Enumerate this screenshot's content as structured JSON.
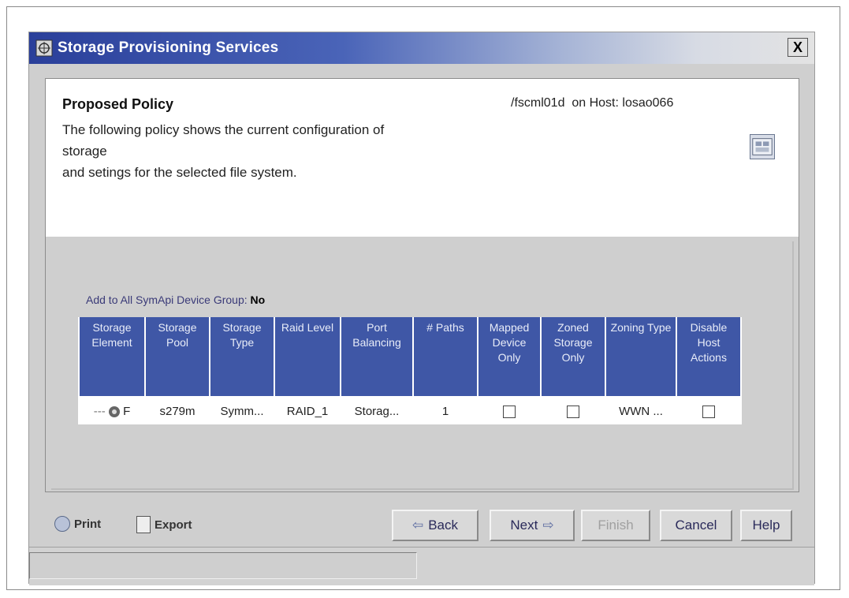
{
  "window": {
    "title": "Storage Provisioning Services",
    "close_label": "X"
  },
  "header": {
    "title": "Proposed Policy",
    "description_lines": [
      "The following policy shows the current configuration of",
      "storage",
      "and setings for the selected file system."
    ],
    "filesystem": "/fscml01d",
    "on_host_label": "on Host:",
    "host": "losao066"
  },
  "device_group": {
    "label": "Add to All SymApi Device Group:",
    "value": "No"
  },
  "table": {
    "columns": [
      "Storage Element",
      "Storage Pool",
      "Storage Type",
      "Raid Level",
      "Port Balancing",
      "# Paths",
      "Mapped Device Only",
      "Zoned Storage Only",
      "Zoning Type",
      "Disable Host Actions"
    ],
    "rows": [
      {
        "storage_element": "F",
        "storage_pool": "s279m",
        "storage_type": "Symm...",
        "raid_level": "RAID_1",
        "port_balancing": "Storag...",
        "paths": "1",
        "mapped_device_only": false,
        "zoned_storage_only": false,
        "zoning_type": "WWN ...",
        "disable_host_actions": false
      }
    ]
  },
  "footer": {
    "print_label": "Print",
    "export_label": "Export",
    "back_label": "Back",
    "next_label": "Next",
    "finish_label": "Finish",
    "cancel_label": "Cancel",
    "help_label": "Help"
  },
  "status": {
    "text": ""
  }
}
